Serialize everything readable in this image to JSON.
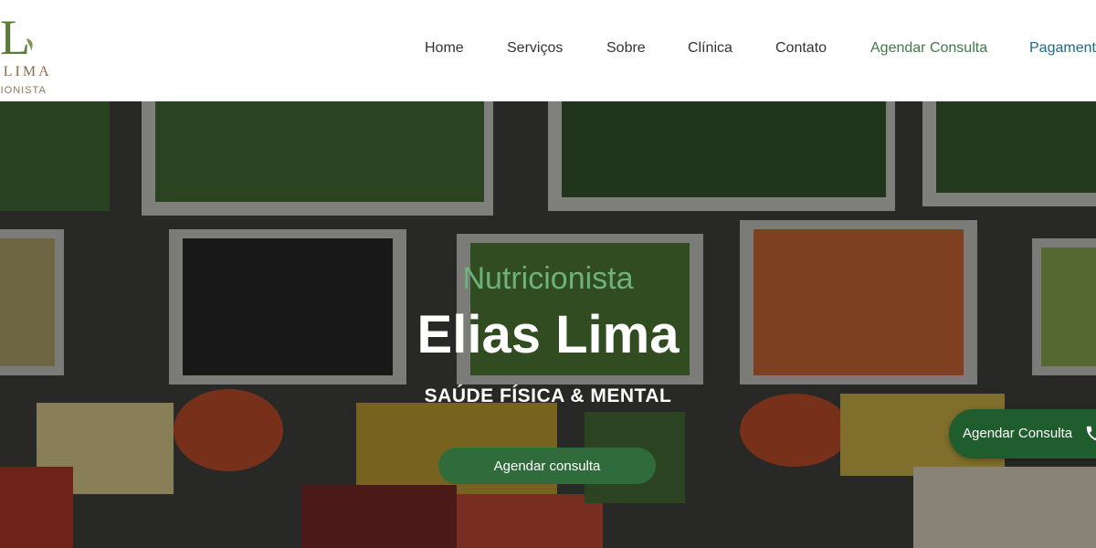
{
  "brand": {
    "monogram": "L",
    "name": "IAS LIMA",
    "subtitle": "UTRICIONISTA"
  },
  "nav": {
    "items": [
      {
        "label": "Home"
      },
      {
        "label": "Serviços"
      },
      {
        "label": "Sobre"
      },
      {
        "label": "Clínica"
      },
      {
        "label": "Contato"
      },
      {
        "label": "Agendar Consulta"
      },
      {
        "label": "Pagament"
      }
    ]
  },
  "hero": {
    "eyebrow": "Nutricionista",
    "title": "Elias Lima",
    "tagline": "SAÚDE FÍSICA & MENTAL",
    "cta_label": "Agendar consulta",
    "background_icon": "vegetables-photo"
  },
  "floating_cta": {
    "label": "Agendar Consulta",
    "icon": "phone-icon"
  },
  "colors": {
    "brand_green": "#3f7a4c",
    "eyebrow_green": "#6db27a",
    "cta_green": "#2f6b3b",
    "float_green": "#1f5c2e",
    "payment_teal": "#1c6a8a"
  }
}
